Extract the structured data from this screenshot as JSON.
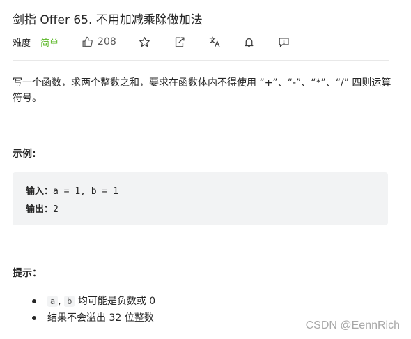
{
  "problem": {
    "title": "剑指 Offer 65. 不用加减乘除做加法",
    "difficulty_label": "难度",
    "difficulty": "简单",
    "like_count": "208"
  },
  "toolbar": {
    "icons": [
      "thumb-up-icon",
      "star-icon",
      "share-icon",
      "translate-icon",
      "bell-icon",
      "feedback-icon"
    ]
  },
  "description": {
    "text": "写一个函数，求两个整数之和，要求在函数体内不得使用 “+”、“-”、“*”、“/” 四则运算符号。"
  },
  "example": {
    "heading": "示例:",
    "input_label": "输入：",
    "input_value": "a = 1, b = 1",
    "output_label": "输出：",
    "output_value": "2"
  },
  "tips": {
    "heading": "提示：",
    "item1_code_a": "a",
    "item1_sep": ",",
    "item1_code_b": "b",
    "item1_text": "均可能是负数或 0",
    "item2_text": "结果不会溢出 32 位整数"
  },
  "watermark": "CSDN @EennRich",
  "colors": {
    "difficulty_easy": "#5ab726",
    "code_background": "#f2f3f4",
    "text": "#262626"
  }
}
